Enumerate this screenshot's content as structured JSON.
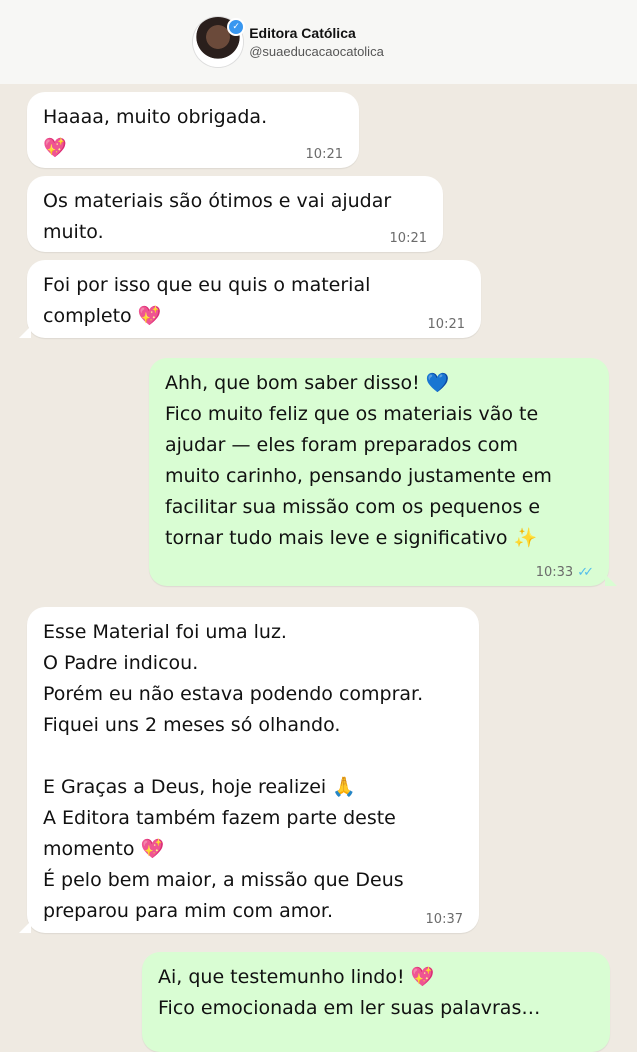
{
  "header": {
    "name": "Editora Católica",
    "handle": "@suaeducacaocatolica"
  },
  "messages": [
    {
      "id": "m1",
      "direction": "in",
      "text": "Haaaa, muito obrigada.\n💖",
      "time": "10:21"
    },
    {
      "id": "m2",
      "direction": "in",
      "text": "Os materiais são ótimos e vai ajudar\nmuito.",
      "time": "10:21"
    },
    {
      "id": "m3",
      "direction": "in",
      "text": "Foi por isso que eu quis o material\ncompleto 💖",
      "time": "10:21"
    },
    {
      "id": "m4",
      "direction": "out",
      "text": "Ahh, que bom saber disso! 💙\nFico muito feliz que os materiais vão te\najudar — eles foram preparados com\nmuito carinho, pensando justamente em\nfacilitar sua missão com os pequenos e\ntornar tudo mais leve e significativo ✨",
      "time": "10:33",
      "read": true
    },
    {
      "id": "m5",
      "direction": "in",
      "text": "Esse Material foi uma luz.\nO Padre indicou.\nPorém eu não estava podendo comprar.\nFiquei uns 2 meses só olhando.\n\nE Graças a Deus, hoje realizei 🙏\nA Editora também fazem parte deste\nmomento 💖\nÉ pelo bem maior, a missão que Deus\npreparou para mim com amor.",
      "time": "10:37"
    },
    {
      "id": "m6",
      "direction": "out",
      "text": "Ai, que testemunho lindo! 💖\nFico emocionada em ler suas palavras…",
      "time": ""
    }
  ],
  "colors": {
    "chat_background": "#efeae2",
    "incoming_bubble": "#ffffff",
    "outgoing_bubble": "#d9fdd3",
    "read_ticks": "#53bdeb"
  },
  "icons": {
    "verified": "verified-badge-icon",
    "read_receipt": "double-check-icon"
  }
}
